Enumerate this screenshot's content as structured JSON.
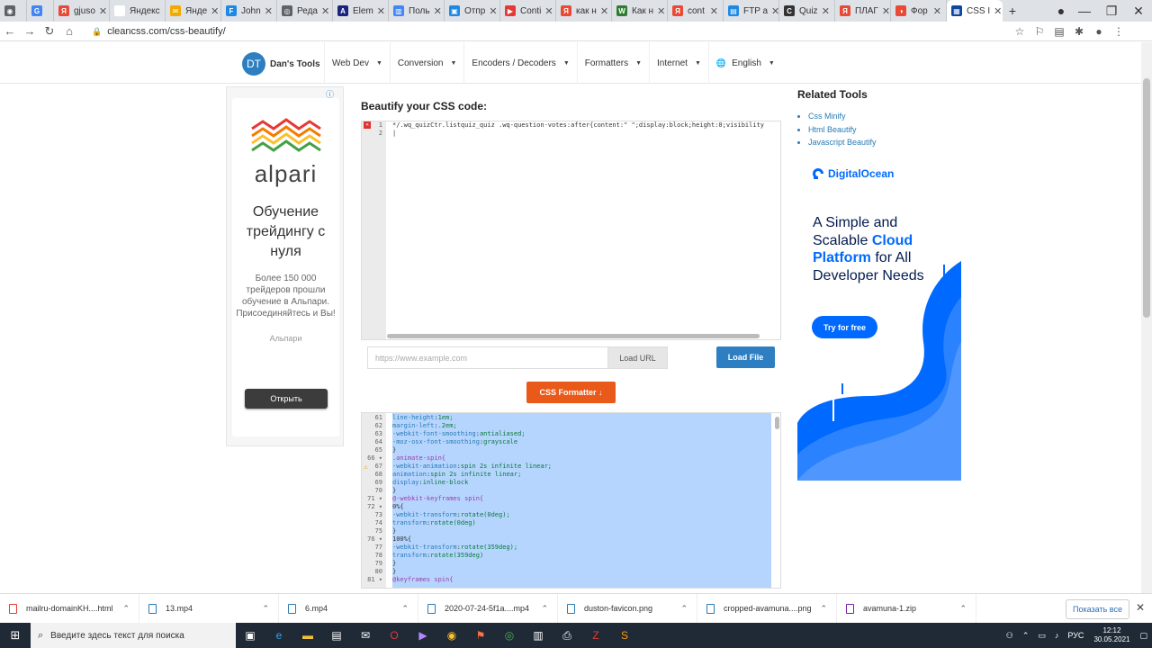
{
  "browser": {
    "tabs": [
      {
        "label": "",
        "fav": "#5f6368",
        "letter": "◉"
      },
      {
        "label": "",
        "fav": "#4285f4",
        "letter": "G"
      },
      {
        "label": "gjuso",
        "fav": "#e84a36",
        "letter": "Я"
      },
      {
        "label": "Яндекс",
        "fav": "#ffffff",
        "letter": ""
      },
      {
        "label": "Янде",
        "fav": "#f2a900",
        "letter": "✉"
      },
      {
        "label": "John",
        "fav": "#1e88e5",
        "letter": "F"
      },
      {
        "label": "Реда",
        "fav": "#5f6368",
        "letter": "◎"
      },
      {
        "label": "Elem",
        "fav": "#1a237e",
        "letter": "A"
      },
      {
        "label": "Поль",
        "fav": "#4285f4",
        "letter": "▥"
      },
      {
        "label": "Отпр",
        "fav": "#1e88e5",
        "letter": "▣"
      },
      {
        "label": "Conti",
        "fav": "#e53935",
        "letter": "▶"
      },
      {
        "label": "как н",
        "fav": "#e84a36",
        "letter": "Я"
      },
      {
        "label": "Как н",
        "fav": "#2e7d32",
        "letter": "W"
      },
      {
        "label": "cont",
        "fav": "#e84a36",
        "letter": "Я"
      },
      {
        "label": "FTP а",
        "fav": "#1e88e5",
        "letter": "▤"
      },
      {
        "label": "Quiz",
        "fav": "#333333",
        "letter": "C"
      },
      {
        "label": "ПЛАГ",
        "fav": "#e84a36",
        "letter": "Я"
      },
      {
        "label": "Фор",
        "fav": "#e84a36",
        "letter": "◑"
      },
      {
        "label": "CSS I",
        "fav": "#0d47a1",
        "letter": "▦"
      }
    ],
    "url": "cleancss.com/css-beautify/"
  },
  "site": {
    "logo_initials": "DT",
    "logo_name": "Dan's Tools",
    "menu": [
      "Web Dev",
      "Conversion",
      "Encoders / Decoders",
      "Formatters",
      "Internet",
      "English"
    ]
  },
  "ad_left": {
    "brand_word": "alpari",
    "headline": "Обучение трейдингу с нуля",
    "body": "Более 150 000 трейдеров прошли обучение в Альпари. Присоединяйтесь и Вы!",
    "advertiser": "Альпари",
    "button": "Открыть"
  },
  "main": {
    "title": "Beautify your CSS code:",
    "input_line_1": "*/.wq_quizCtr.listquiz_quiz .wq-question-votes:after{content:\" \";display:block;height:0;visibility",
    "url_placeholder": "https://www.example.com",
    "load_url": "Load URL",
    "load_file": "Load File",
    "formatter": "CSS Formatter ↓",
    "output_lines": [
      {
        "n": "61",
        "code": "    line-height:1em;"
      },
      {
        "n": "62",
        "code": "    margin-left:.2em;"
      },
      {
        "n": "63",
        "code": "    -webkit-font-smoothing:antialiased;"
      },
      {
        "n": "64",
        "code": "    -moz-osx-font-smoothing:grayscale"
      },
      {
        "n": "65",
        "code": "}"
      },
      {
        "n": "66 ▾",
        "code": ".animate-spin{"
      },
      {
        "n": "67",
        "code": "    -webkit-animation:spin 2s infinite linear;"
      },
      {
        "n": "68",
        "code": "    animation:spin 2s infinite linear;"
      },
      {
        "n": "69",
        "code": "    display:inline-block"
      },
      {
        "n": "70",
        "code": "}"
      },
      {
        "n": "71 ▾",
        "code": "@-webkit-keyframes spin{"
      },
      {
        "n": "72 ▾",
        "code": "    0%{"
      },
      {
        "n": "73",
        "code": "        -webkit-transform:rotate(0deg);"
      },
      {
        "n": "74",
        "code": "        transform:rotate(0deg)"
      },
      {
        "n": "75",
        "code": "    }"
      },
      {
        "n": "76 ▾",
        "code": "    100%{"
      },
      {
        "n": "77",
        "code": "        -webkit-transform:rotate(359deg);"
      },
      {
        "n": "78",
        "code": "        transform:rotate(359deg)"
      },
      {
        "n": "79",
        "code": "    }"
      },
      {
        "n": "80",
        "code": "}"
      },
      {
        "n": "81 ▾",
        "code": "@keyframes spin{"
      }
    ]
  },
  "side": {
    "title": "Related Tools",
    "links": [
      "Css Minify",
      "Html Beautify",
      "Javascript Beautify"
    ]
  },
  "ad_right": {
    "brand": "DigitalOcean",
    "headline_plain_1": "A Simple and Scalable ",
    "headline_bold_1": "Cloud Platform",
    "headline_plain_2": " for All Developer Needs",
    "button": "Try for free"
  },
  "downloads": [
    {
      "name": "mailru-domainKH....html",
      "color": "#e53935"
    },
    {
      "name": "13.mp4",
      "color": "#2a7bb5"
    },
    {
      "name": "6.mp4",
      "color": "#2a7bb5"
    },
    {
      "name": "2020-07-24-5f1a....mp4",
      "color": "#2a7bb5"
    },
    {
      "name": "duston-favicon.png",
      "color": "#2a7bb5"
    },
    {
      "name": "cropped-avamuna....png",
      "color": "#2a7bb5"
    },
    {
      "name": "avamuna-1.zip",
      "color": "#7b1fa2"
    }
  ],
  "downloads_show_all": "Показать все",
  "taskbar": {
    "search_placeholder": "Введите здесь текст для поиска",
    "lang": "РУС",
    "time": "12:12",
    "date": "30.05.2021"
  }
}
